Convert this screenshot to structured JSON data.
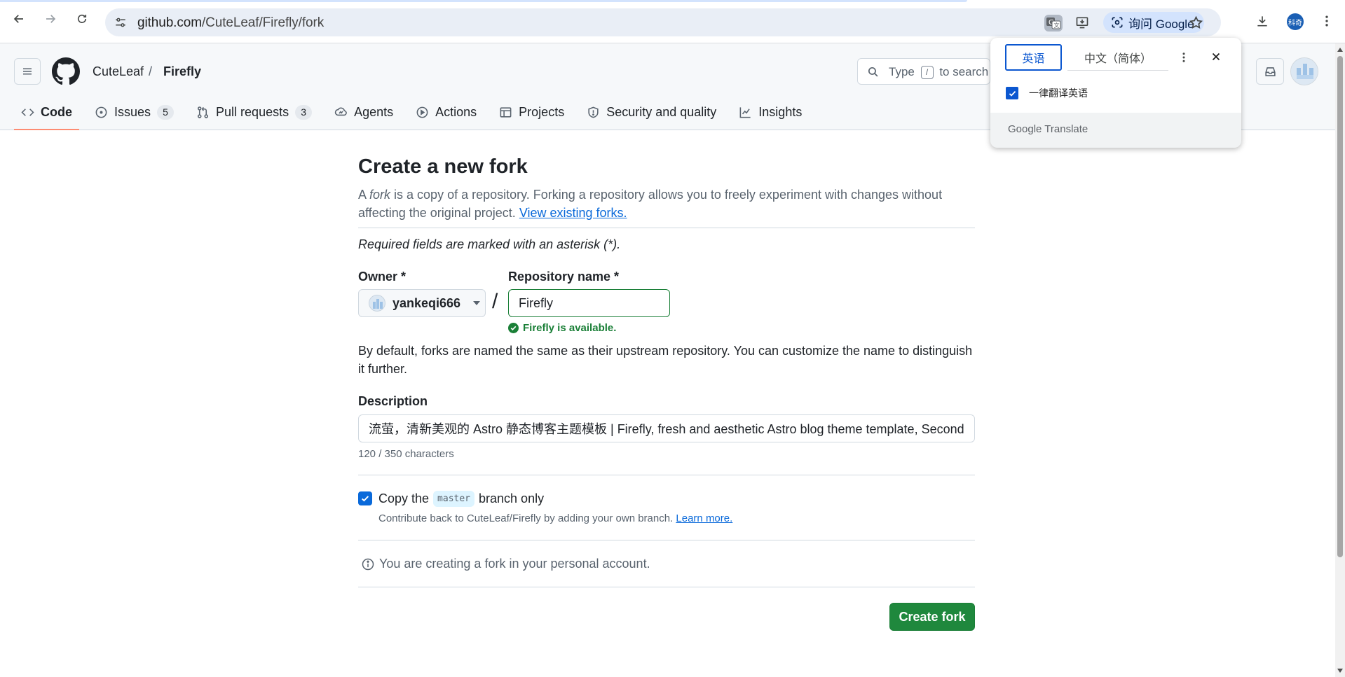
{
  "browser": {
    "url_domain": "github.com",
    "url_path": "/CuteLeaf/Firefly/fork",
    "ask_google_label": "询问 Google",
    "profile_label": "科奇"
  },
  "translate_popup": {
    "source_lang": "英语",
    "target_lang": "中文（简体）",
    "always_translate_label": "一律翻译英语",
    "always_translate_checked": true,
    "brand_google": "Google",
    "brand_translate": "Translate"
  },
  "header": {
    "owner": "CuteLeaf",
    "separator": "/",
    "repo": "Firefly",
    "search_prefix": "Type",
    "search_key": "/",
    "search_suffix": "to search"
  },
  "tabs": [
    {
      "label": "Code",
      "icon": "code-icon",
      "active": true
    },
    {
      "label": "Issues",
      "icon": "issue-icon",
      "count": "5"
    },
    {
      "label": "Pull requests",
      "icon": "pull-request-icon",
      "count": "3"
    },
    {
      "label": "Agents",
      "icon": "agents-icon"
    },
    {
      "label": "Actions",
      "icon": "play-icon"
    },
    {
      "label": "Projects",
      "icon": "table-icon"
    },
    {
      "label": "Security and quality",
      "icon": "shield-icon"
    },
    {
      "label": "Insights",
      "icon": "graph-icon"
    }
  ],
  "form": {
    "title": "Create a new fork",
    "intro_prefix": "A ",
    "intro_fork_word": "fork",
    "intro_body": " is a copy of a repository. Forking a repository allows you to freely experiment with changes without affecting the original project. ",
    "intro_link": "View existing forks.",
    "required_note": "Required fields are marked with an asterisk (*).",
    "owner_label": "Owner *",
    "owner_value": "yankeqi666",
    "slash": "/",
    "repo_name_label": "Repository name *",
    "repo_name_value": "Firefly",
    "availability_message": "Firefly is available.",
    "name_help": "By default, forks are named the same as their upstream repository. You can customize the name to distinguish it further.",
    "description_label": "Description",
    "description_value": "流萤，清新美观的 Astro 静态博客主题模板 | Firefly, fresh and aesthetic Astro blog theme template, Secondary",
    "char_count": "120 / 350 characters",
    "copy_branch_checked": true,
    "copy_prefix": "Copy the",
    "copy_branch": "master",
    "copy_suffix": "branch only",
    "copy_help": "Contribute back to CuteLeaf/Firefly by adding your own branch.",
    "copy_help_link": "Learn more.",
    "personal_note": "You are creating a fork in your personal account.",
    "create_button": "Create fork"
  },
  "colors": {
    "primary_button": "#1f883d",
    "success_text": "#1a7f37",
    "link": "#0969da",
    "active_tab_underline": "#fd8c73",
    "checkbox": "#0969da"
  }
}
